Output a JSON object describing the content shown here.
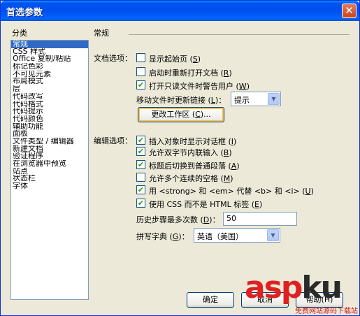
{
  "window": {
    "title": "首选参数",
    "close_glyph": "✕"
  },
  "sidebar": {
    "heading": "分类",
    "items": [
      {
        "label": "常规"
      },
      {
        "label": "CSS 样式"
      },
      {
        "label": "Office 复制/粘贴"
      },
      {
        "label": "标记色彩"
      },
      {
        "label": "不可见元素"
      },
      {
        "label": "布局模式"
      },
      {
        "label": "层"
      },
      {
        "label": "代码改写"
      },
      {
        "label": "代码格式"
      },
      {
        "label": "代码提示"
      },
      {
        "label": "代码颜色"
      },
      {
        "label": "辅助功能"
      },
      {
        "label": "面板"
      },
      {
        "label": "文件类型 / 编辑器"
      },
      {
        "label": "新建文档"
      },
      {
        "label": "验证程序"
      },
      {
        "label": "在浏览器中预览"
      },
      {
        "label": "站点"
      },
      {
        "label": "状态栏"
      },
      {
        "label": "字体"
      }
    ],
    "selected_index": 0
  },
  "section": {
    "title": "常规"
  },
  "doc_options": {
    "label": "文档选项：",
    "show_start_page": {
      "label": "显示起始页",
      "hotkey": "S",
      "checked": false
    },
    "reopen_docs": {
      "label": "启动时重新打开文档",
      "hotkey": "R",
      "checked": false
    },
    "warn_readonly": {
      "label": "打开只读文件时警告用户",
      "hotkey": "W",
      "checked": true
    },
    "update_links": {
      "label": "移动文件时更新链接",
      "hotkey": "L",
      "value": "提示"
    },
    "change_workspace": {
      "label": "更改工作区",
      "hotkey": "C"
    }
  },
  "edit_options": {
    "label": "编辑选项：",
    "items": [
      {
        "label": "插入对象时显示对话框",
        "hotkey": "I",
        "checked": true
      },
      {
        "label": "允许双字节内联输入",
        "hotkey": "B",
        "checked": true
      },
      {
        "label": "标题后切换到普通段落",
        "hotkey": "A",
        "checked": true
      },
      {
        "label": "允许多个连续的空格",
        "hotkey": "M",
        "checked": false
      },
      {
        "label": "用 <strong> 和 <em> 代替 <b> 和 <i>",
        "hotkey": "U",
        "checked": true
      },
      {
        "label": "使用 CSS 而不是 HTML 标签",
        "hotkey": "E",
        "checked": true
      }
    ],
    "history_steps": {
      "label": "历史步骤最多次数",
      "hotkey": "D",
      "value": "50"
    },
    "spelling_dict": {
      "label": "拼写字典",
      "hotkey": "G",
      "value": "英语（美国）"
    }
  },
  "footer": {
    "ok_label": "确定",
    "cancel_label": "取消",
    "help_label": "帮助(H)"
  },
  "watermark": {
    "brand_main": "asp",
    "brand_ku": "ku",
    "tagline": "免费网站源码下载站"
  },
  "check_glyph": "✔",
  "arrow_glyph": "▼"
}
